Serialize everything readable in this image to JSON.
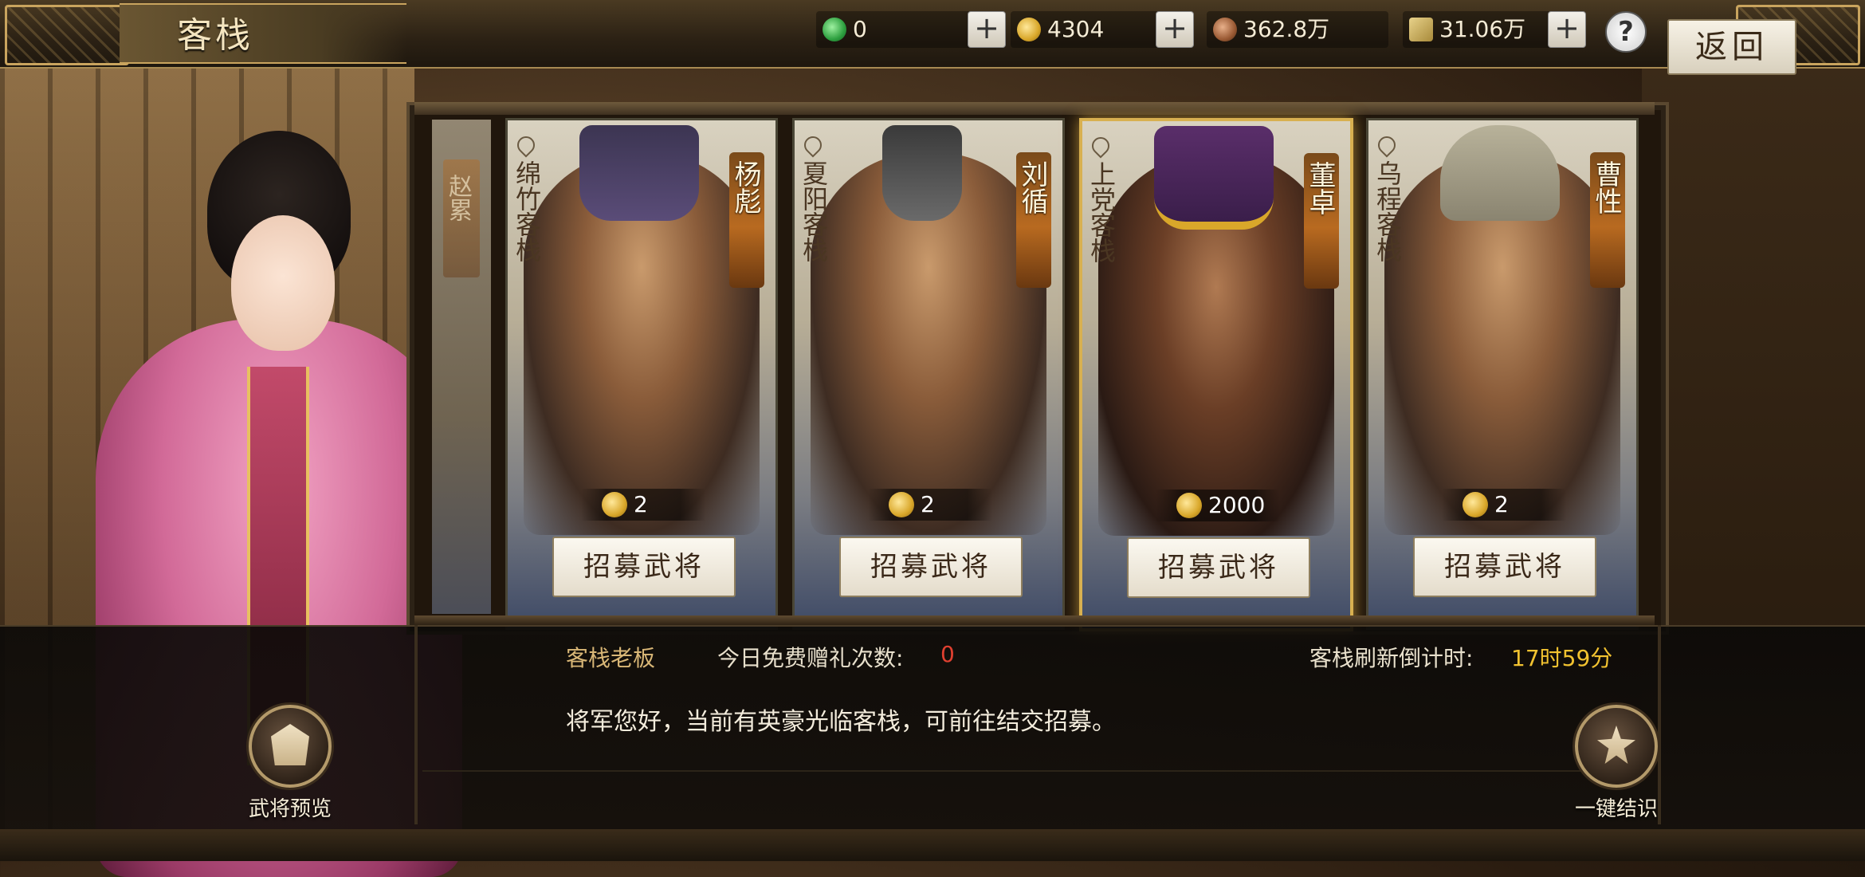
{
  "header": {
    "title": "客栈",
    "back_label": "返回",
    "help_label": "?"
  },
  "resources": [
    {
      "icon": "jade-icon",
      "value": "0"
    },
    {
      "icon": "gold-coin-icon",
      "value": "4304"
    },
    {
      "icon": "copper-coin-icon",
      "value": "362.8万"
    },
    {
      "icon": "grain-icon",
      "value": "31.06万"
    }
  ],
  "side_card": {
    "name": "赵累"
  },
  "cards": [
    {
      "location": "绵竹客栈",
      "name": "杨彪",
      "cost": "2",
      "button": "招募武将"
    },
    {
      "location": "夏阳客栈",
      "name": "刘循",
      "cost": "2",
      "button": "招募武将"
    },
    {
      "location": "上党客栈",
      "name": "董卓",
      "cost": "2000",
      "button": "招募武将"
    },
    {
      "location": "乌程客栈",
      "name": "曹性",
      "cost": "2",
      "button": "招募武将"
    }
  ],
  "dialog": {
    "speaker": "客栈老板",
    "gift_label": "今日免费赠礼次数:",
    "gift_count": "0",
    "refresh_label": "客栈刷新倒计时:",
    "refresh_time": "17时59分",
    "text": "将军您好，当前有英豪光临客栈，可前往结交招募。"
  },
  "actions": {
    "preview_label": "武将预览",
    "quick_label": "一键结识"
  },
  "colors": {
    "accent_gold": "#c9a45e",
    "gift_count": "#e04030",
    "refresh_time": "#f2c230"
  }
}
